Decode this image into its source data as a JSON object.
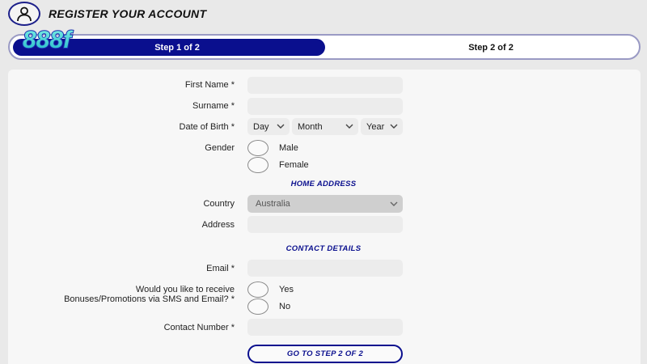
{
  "header": {
    "title": "REGISTER YOUR ACCOUNT"
  },
  "logo": {
    "text": "888f"
  },
  "steps": {
    "step1": "Step 1 of 2",
    "step2": "Step 2 of 2"
  },
  "form": {
    "first_name_label": "First Name *",
    "surname_label": "Surname *",
    "dob_label": "Date of Birth *",
    "dob_day": "Day",
    "dob_month": "Month",
    "dob_year": "Year",
    "gender_label": "Gender",
    "gender_male": "Male",
    "gender_female": "Female",
    "home_address_title": "HOME ADDRESS",
    "country_label": "Country",
    "country_value": "Australia",
    "address_label": "Address",
    "contact_details_title": "CONTACT DETAILS",
    "email_label": "Email *",
    "promo_label_line1": "Would you like to receive",
    "promo_label_line2": "Bonuses/Promotions via SMS and Email? *",
    "promo_yes": "Yes",
    "promo_no": "No",
    "contact_number_label": "Contact Number *",
    "submit_label": "GO TO STEP 2 OF 2"
  },
  "colors": {
    "brand": "#0a0f8e",
    "logo_teal": "#2fd3c9",
    "logo_blue": "#1a3fd0"
  }
}
